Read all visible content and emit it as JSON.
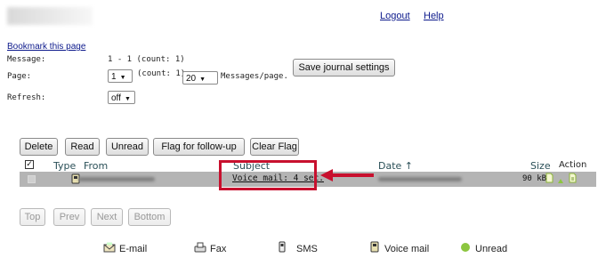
{
  "header": {
    "logout": "Logout",
    "help": "Help"
  },
  "settings": {
    "bookmark": "Bookmark this page",
    "message_label": "Message:",
    "message_value": "1 - 1 (count: 1)",
    "page_label": "Page:",
    "page_value": "1",
    "page_count": "(count: 1),",
    "per_page_value": "20",
    "per_page_suffix": "Messages/page.",
    "refresh_label": "Refresh:",
    "refresh_value": "off",
    "save_button": "Save journal settings"
  },
  "toolbar": {
    "delete": "Delete",
    "read": "Read",
    "unread": "Unread",
    "flag": "Flag for follow-up",
    "clear_flag": "Clear Flag"
  },
  "table": {
    "headers": {
      "type": "Type",
      "from": "From",
      "subject": "Subject",
      "date": "Date ↑",
      "size": "Size",
      "action": "Action"
    },
    "rows": [
      {
        "subject": "Voice mail: 4 sec.",
        "size": "90 kB"
      }
    ]
  },
  "pager": {
    "top": "Top",
    "prev": "Prev",
    "next": "Next",
    "bottom": "Bottom"
  },
  "legend": {
    "email": "E-mail",
    "fax": "Fax",
    "sms": "SMS",
    "voicemail": "Voice mail",
    "unread": "Unread"
  },
  "colors": {
    "highlight_box": "#c8102e",
    "row_bg": "#b4b4b4",
    "unread_dot": "#8cc63f",
    "link": "#0d1a8c"
  }
}
